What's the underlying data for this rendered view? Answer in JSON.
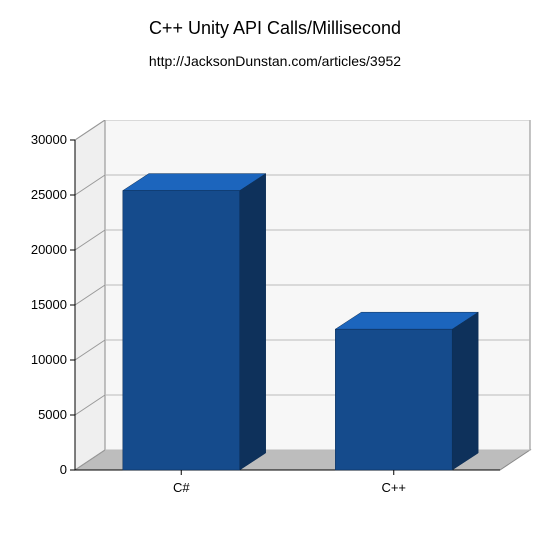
{
  "title": "C++ Unity API Calls/Millisecond",
  "subtitle": "http://JacksonDunstan.com/articles/3952",
  "chart_data": {
    "type": "bar",
    "categories": [
      "C#",
      "C++"
    ],
    "values": [
      25400,
      12800
    ],
    "title": "C++ Unity API Calls/Millisecond",
    "xlabel": "",
    "ylabel": "",
    "ylim": [
      0,
      30000
    ],
    "yticks": [
      0,
      5000,
      10000,
      15000,
      20000,
      25000,
      30000
    ],
    "style": "3d",
    "bar_color": "#154b8c"
  }
}
